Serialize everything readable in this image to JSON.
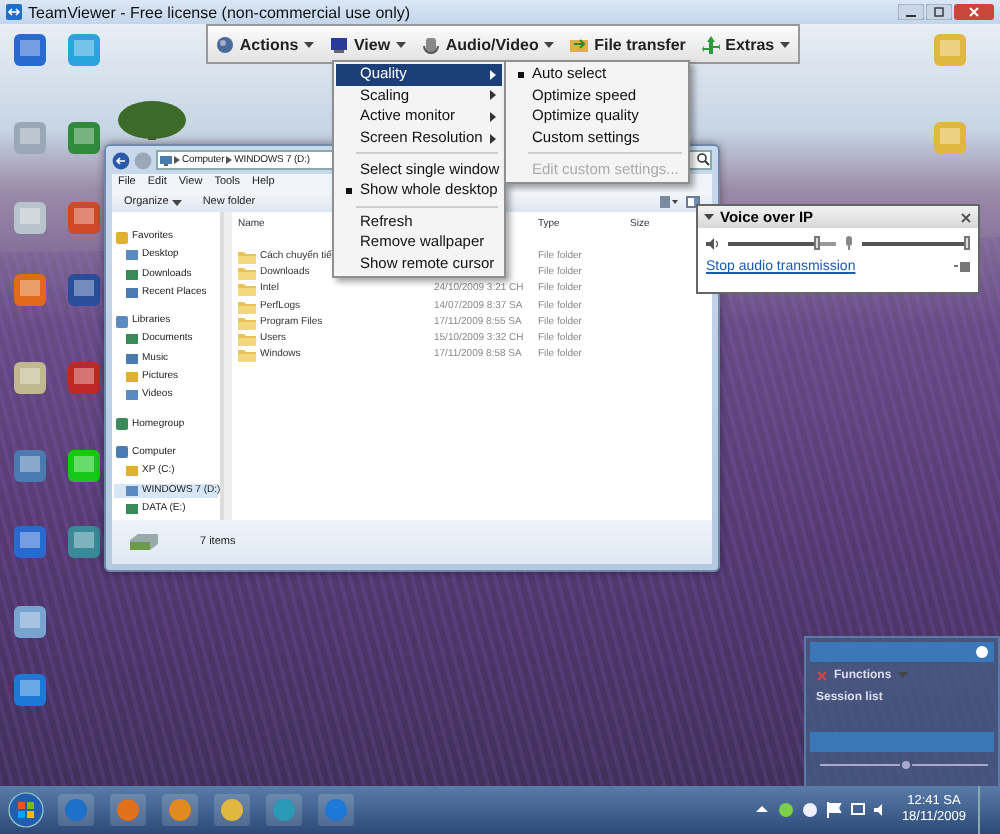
{
  "window": {
    "title": "TeamViewer - Free license (non-commercial use only)"
  },
  "toolbar": [
    {
      "label": "Actions",
      "dropdown": true
    },
    {
      "label": "View",
      "dropdown": true
    },
    {
      "label": "Audio/Video",
      "dropdown": true
    },
    {
      "label": "File transfer",
      "dropdown": false
    },
    {
      "label": "Extras",
      "dropdown": true
    }
  ],
  "view_menu": {
    "items": [
      {
        "kind": "item",
        "label": "Quality",
        "submenu": true,
        "selected": true,
        "checked": false
      },
      {
        "kind": "item",
        "label": "Scaling",
        "submenu": true,
        "selected": false,
        "checked": false
      },
      {
        "kind": "item",
        "label": "Active monitor",
        "submenu": true,
        "selected": false,
        "checked": false
      },
      {
        "kind": "item",
        "label": "Screen Resolution",
        "submenu": true,
        "selected": false,
        "checked": false
      },
      {
        "kind": "separator"
      },
      {
        "kind": "item",
        "label": "Select single window",
        "submenu": false,
        "selected": false,
        "checked": false
      },
      {
        "kind": "item",
        "label": "Show whole desktop",
        "submenu": false,
        "selected": false,
        "checked": true
      },
      {
        "kind": "separator"
      },
      {
        "kind": "item",
        "label": "Refresh",
        "submenu": false,
        "selected": false,
        "checked": false
      },
      {
        "kind": "item",
        "label": "Remove wallpaper",
        "submenu": false,
        "selected": false,
        "checked": false
      },
      {
        "kind": "item",
        "label": "Show remote cursor",
        "submenu": false,
        "selected": false,
        "checked": false
      }
    ]
  },
  "quality_submenu": {
    "items": [
      {
        "kind": "item",
        "label": "Auto select",
        "checked": true,
        "disabled": false
      },
      {
        "kind": "item",
        "label": "Optimize speed",
        "checked": false,
        "disabled": false
      },
      {
        "kind": "item",
        "label": "Optimize quality",
        "checked": false,
        "disabled": false
      },
      {
        "kind": "item",
        "label": "Custom settings",
        "checked": false,
        "disabled": false
      },
      {
        "kind": "separator"
      },
      {
        "kind": "item",
        "label": "Edit custom settings...",
        "checked": false,
        "disabled": true
      }
    ]
  },
  "explorer": {
    "address": [
      "Computer",
      "WINDOWS 7 (D:)"
    ],
    "menu": [
      "File",
      "Edit",
      "View",
      "Tools",
      "Help"
    ],
    "commands": [
      {
        "label": "Organize",
        "dropdown": true
      },
      {
        "label": "New folder",
        "dropdown": false
      }
    ],
    "navigation": [
      {
        "label": "Favorites",
        "selected": false,
        "children": [
          {
            "label": "Desktop",
            "selected": false
          },
          {
            "label": "Downloads",
            "selected": false
          },
          {
            "label": "Recent Places",
            "selected": false
          }
        ]
      },
      {
        "label": "Libraries",
        "selected": false,
        "children": [
          {
            "label": "Documents",
            "selected": false
          },
          {
            "label": "Music",
            "selected": false
          },
          {
            "label": "Pictures",
            "selected": false
          },
          {
            "label": "Videos",
            "selected": false
          }
        ]
      },
      {
        "label": "Homegroup",
        "selected": false
      },
      {
        "label": "Computer",
        "selected": false,
        "children": [
          {
            "label": "XP (C:)",
            "selected": false
          },
          {
            "label": "WINDOWS 7 (D:)",
            "selected": true
          },
          {
            "label": "DATA (E:)",
            "selected": false
          }
        ]
      }
    ],
    "columns": [
      "Name",
      "Type",
      "Size"
    ],
    "rows": [
      {
        "name": "Cách chuyển tiế",
        "type": "File folder"
      },
      {
        "name": "Downloads",
        "type": "File folder"
      },
      {
        "name": "Intel",
        "date": "24/10/2009 3:21 CH",
        "type": "File folder"
      },
      {
        "name": "PerfLogs",
        "date": "14/07/2009 8:37 SA",
        "type": "File folder"
      },
      {
        "name": "Program Files",
        "date": "17/11/2009 8:55 SA",
        "type": "File folder"
      },
      {
        "name": "Users",
        "date": "15/10/2009 3:32 CH",
        "type": "File folder"
      },
      {
        "name": "Windows",
        "date": "17/11/2009 8:58 SA",
        "type": "File folder"
      }
    ],
    "status": "7 items"
  },
  "voice_over_ip": {
    "title": "Voice over IP",
    "speaker": {
      "level": 0.85
    },
    "microphone": {
      "level": 1
    },
    "link": "Stop audio transmission"
  },
  "session_panel": {
    "functions": "Functions",
    "session_list": "Session list"
  },
  "taskbar": {
    "time": "12:41 SA",
    "date": "18/11/2009"
  }
}
